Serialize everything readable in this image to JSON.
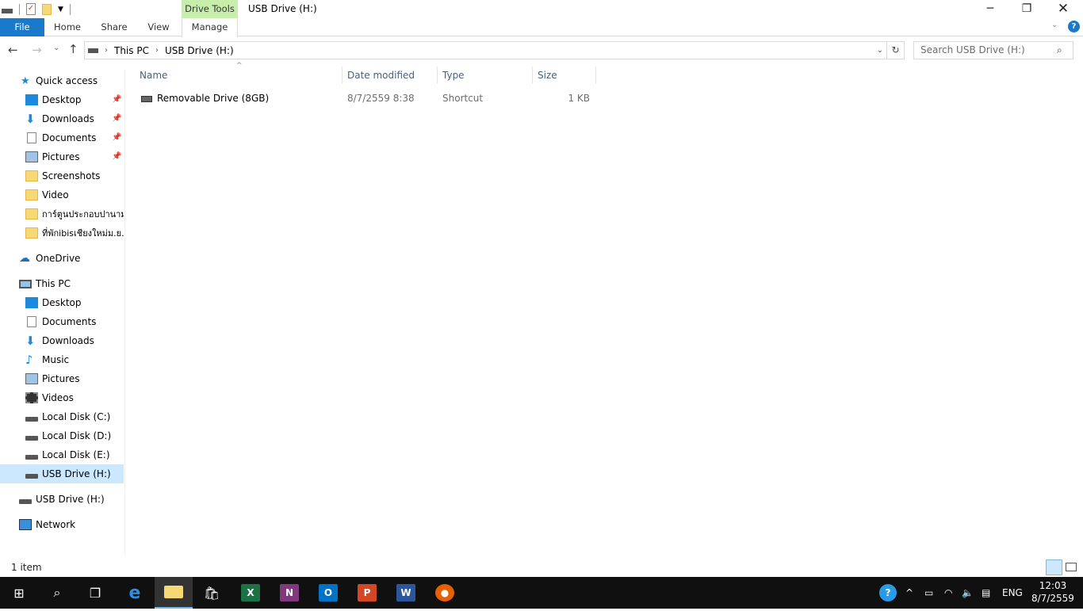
{
  "window": {
    "title": "USB Drive (H:)",
    "context_tab": "Drive Tools"
  },
  "ribbon": {
    "tabs": [
      "File",
      "Home",
      "Share",
      "View",
      "Manage"
    ]
  },
  "address": {
    "crumbs": [
      "This PC",
      "USB Drive (H:)"
    ],
    "search_placeholder": "Search USB Drive (H:)"
  },
  "nav": {
    "quick_access": "Quick access",
    "quick_items": [
      "Desktop",
      "Downloads",
      "Documents",
      "Pictures",
      "Screenshots",
      "Video",
      "การ์ตูนประกอบปานามา",
      "ที่พักibisเชียงใหม่ม.ย.-"
    ],
    "onedrive": "OneDrive",
    "this_pc": "This PC",
    "pc_items": [
      "Desktop",
      "Documents",
      "Downloads",
      "Music",
      "Pictures",
      "Videos",
      "Local Disk (C:)",
      "Local Disk (D:)",
      "Local Disk (E:)",
      "USB Drive (H:)"
    ],
    "usb": "USB Drive (H:)",
    "network": "Network"
  },
  "columns": [
    "Name",
    "Date modified",
    "Type",
    "Size"
  ],
  "files": [
    {
      "name": "Removable Drive (8GB)",
      "date": "8/7/2559 8:38",
      "type": "Shortcut",
      "size": "1 KB"
    }
  ],
  "status": "1 item",
  "tray": {
    "lang": "ENG",
    "time": "12:03",
    "date": "8/7/2559"
  }
}
